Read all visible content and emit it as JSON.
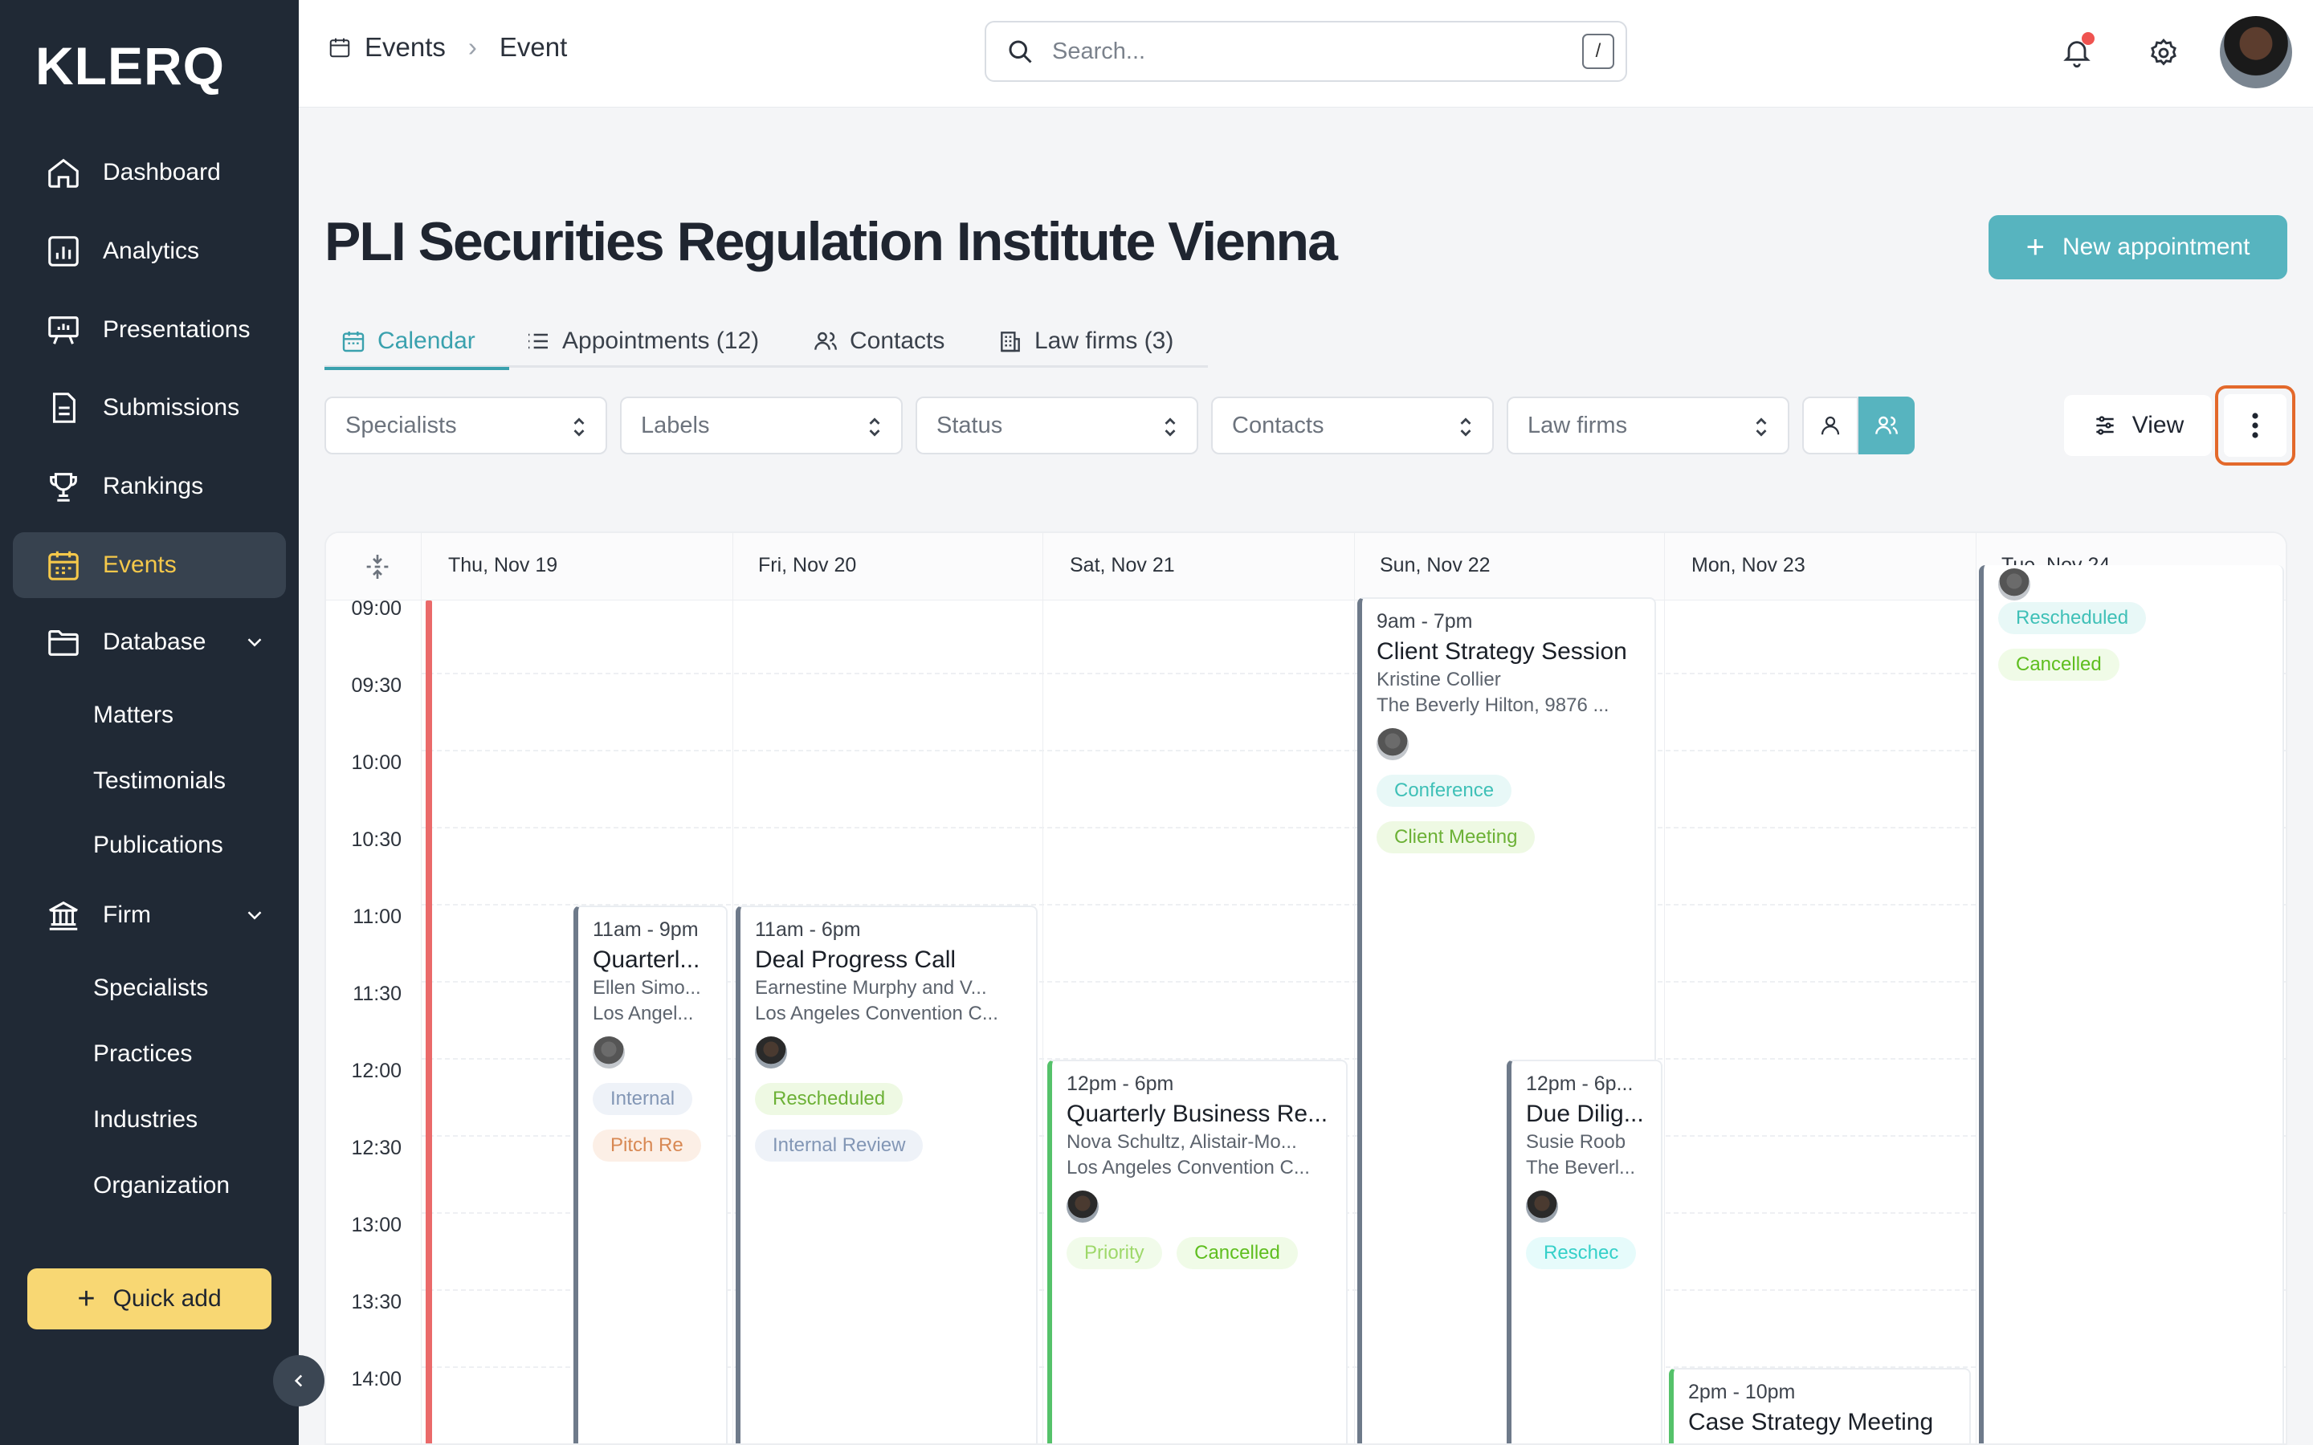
{
  "app": {
    "logo": "KLERQ"
  },
  "sidebar": {
    "items": [
      {
        "label": "Dashboard",
        "icon": "home-icon"
      },
      {
        "label": "Analytics",
        "icon": "analytics-icon"
      },
      {
        "label": "Presentations",
        "icon": "presentation-icon"
      },
      {
        "label": "Submissions",
        "icon": "document-icon"
      },
      {
        "label": "Rankings",
        "icon": "trophy-icon"
      },
      {
        "label": "Events",
        "icon": "calendar-icon",
        "active": true
      },
      {
        "label": "Database",
        "icon": "folder-icon",
        "expandable": true
      },
      {
        "label": "Firm",
        "icon": "bank-icon",
        "expandable": true
      }
    ],
    "database_children": [
      "Matters",
      "Testimonials",
      "Publications"
    ],
    "firm_children": [
      "Specialists",
      "Practices",
      "Industries",
      "Organization"
    ],
    "quick_add": "Quick add"
  },
  "header": {
    "breadcrumb": [
      "Events",
      "Event"
    ],
    "search_placeholder": "Search...",
    "search_shortcut": "/",
    "has_notification": true
  },
  "page": {
    "title": "PLI Securities Regulation Institute Vienna",
    "new_appointment": "New appointment",
    "tabs": [
      {
        "label": "Calendar",
        "active": true
      },
      {
        "label": "Appointments (12)"
      },
      {
        "label": "Contacts"
      },
      {
        "label": "Law firms (3)"
      }
    ],
    "filters": [
      "Specialists",
      "Labels",
      "Status",
      "Contacts",
      "Law firms"
    ],
    "view_label": "View"
  },
  "calendar": {
    "days": [
      "Thu, Nov 19",
      "Fri, Nov 20",
      "Sat, Nov 21",
      "Sun, Nov 22",
      "Mon, Nov 23",
      "Tue, Nov 24"
    ],
    "times": [
      "09:00",
      "09:30",
      "10:00",
      "10:30",
      "11:00",
      "11:30",
      "12:00",
      "12:30",
      "13:00",
      "13:30",
      "14:00"
    ],
    "events": {
      "thu": {
        "time": "11am - 9pm",
        "title": "Quarterl...",
        "people": "Ellen Simo...",
        "location": "Los Angel...",
        "tags": [
          "Internal",
          "Pitch Re"
        ]
      },
      "fri": {
        "time": "11am - 6pm",
        "title": "Deal Progress Call",
        "people": "Earnestine Murphy and V...",
        "location": "Los Angeles Convention C...",
        "tags": [
          "Rescheduled",
          "Internal Review"
        ]
      },
      "sat": {
        "time": "12pm - 6pm",
        "title": "Quarterly Business Re...",
        "people": "Nova Schultz, Alistair-Mo...",
        "location": "Los Angeles Convention C...",
        "tags": [
          "Priority",
          "Cancelled"
        ]
      },
      "sun1": {
        "time": "9am - 7pm",
        "title": "Client Strategy Session",
        "people": "Kristine Collier",
        "location": "The Beverly Hilton, 9876 ...",
        "tags": [
          "Conference",
          "Client Meeting"
        ]
      },
      "sun2": {
        "time": "12pm - 6p...",
        "title": "Due Dilig...",
        "people": "Susie Roob",
        "location": "The Beverl...",
        "tags": [
          "Reschec"
        ]
      },
      "mon": {
        "time": "2pm - 10pm",
        "title": "Case Strategy Meeting"
      },
      "tue": {
        "tags": [
          "Rescheduled",
          "Cancelled"
        ]
      }
    }
  },
  "colors": {
    "accent": "#57b4bf",
    "sidebar": "#202935",
    "active_nav": "#f5c84a",
    "quick_add": "#f8d773",
    "highlight": "#e3692b"
  }
}
